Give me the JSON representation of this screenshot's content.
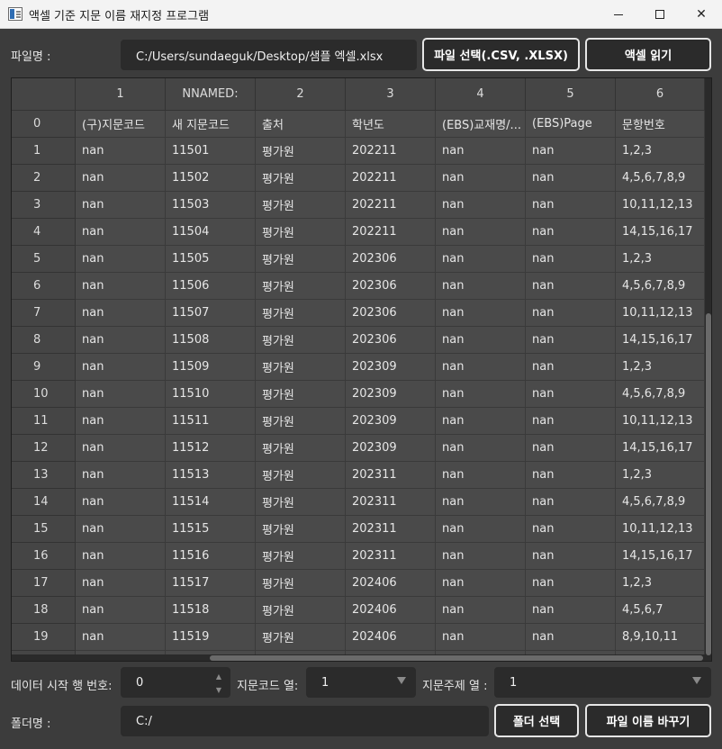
{
  "window": {
    "title": "액셀 기준 지문 이름 재지정 프로그램"
  },
  "file_row": {
    "label": "파일명 :",
    "path": "C:/Users/sundaeguk/Desktop/샘플 엑셀.xlsx",
    "select_button": "파일 선택(.CSV, .XLSX)",
    "read_button": "액셀 읽기"
  },
  "table": {
    "columns": [
      "1",
      "NNAMED:",
      "2",
      "3",
      "4",
      "5",
      "6"
    ],
    "row_numbers": [
      "0",
      "1",
      "2",
      "3",
      "4",
      "5",
      "6",
      "7",
      "8",
      "9",
      "10",
      "11",
      "12",
      "13",
      "14",
      "15",
      "16",
      "17",
      "18",
      "19"
    ],
    "rows": [
      [
        "(구)지문코드",
        "새 지문코드",
        "출처",
        "학년도",
        "(EBS)교재명/...",
        "(EBS)Page",
        "문항번호"
      ],
      [
        "nan",
        "11501",
        "평가원",
        "202211",
        "nan",
        "nan",
        "1,2,3"
      ],
      [
        "nan",
        "11502",
        "평가원",
        "202211",
        "nan",
        "nan",
        "4,5,6,7,8,9"
      ],
      [
        "nan",
        "11503",
        "평가원",
        "202211",
        "nan",
        "nan",
        "10,11,12,13"
      ],
      [
        "nan",
        "11504",
        "평가원",
        "202211",
        "nan",
        "nan",
        "14,15,16,17"
      ],
      [
        "nan",
        "11505",
        "평가원",
        "202306",
        "nan",
        "nan",
        "1,2,3"
      ],
      [
        "nan",
        "11506",
        "평가원",
        "202306",
        "nan",
        "nan",
        "4,5,6,7,8,9"
      ],
      [
        "nan",
        "11507",
        "평가원",
        "202306",
        "nan",
        "nan",
        "10,11,12,13"
      ],
      [
        "nan",
        "11508",
        "평가원",
        "202306",
        "nan",
        "nan",
        "14,15,16,17"
      ],
      [
        "nan",
        "11509",
        "평가원",
        "202309",
        "nan",
        "nan",
        "1,2,3"
      ],
      [
        "nan",
        "11510",
        "평가원",
        "202309",
        "nan",
        "nan",
        "4,5,6,7,8,9"
      ],
      [
        "nan",
        "11511",
        "평가원",
        "202309",
        "nan",
        "nan",
        "10,11,12,13"
      ],
      [
        "nan",
        "11512",
        "평가원",
        "202309",
        "nan",
        "nan",
        "14,15,16,17"
      ],
      [
        "nan",
        "11513",
        "평가원",
        "202311",
        "nan",
        "nan",
        "1,2,3"
      ],
      [
        "nan",
        "11514",
        "평가원",
        "202311",
        "nan",
        "nan",
        "4,5,6,7,8,9"
      ],
      [
        "nan",
        "11515",
        "평가원",
        "202311",
        "nan",
        "nan",
        "10,11,12,13"
      ],
      [
        "nan",
        "11516",
        "평가원",
        "202311",
        "nan",
        "nan",
        "14,15,16,17"
      ],
      [
        "nan",
        "11517",
        "평가원",
        "202406",
        "nan",
        "nan",
        "1,2,3"
      ],
      [
        "nan",
        "11518",
        "평가원",
        "202406",
        "nan",
        "nan",
        "4,5,6,7"
      ],
      [
        "nan",
        "11519",
        "평가원",
        "202406",
        "nan",
        "nan",
        "8,9,10,11"
      ]
    ]
  },
  "settings_row": {
    "start_row_label": "데이터 시작 행 번호:",
    "start_row_value": "0",
    "code_col_label": "지문코드 열:",
    "code_col_value": "1",
    "topic_col_label": "지문주제 열 :",
    "topic_col_value": "1"
  },
  "folder_row": {
    "label": "폴더명 :",
    "path": "C:/",
    "select_button": "폴더 선택",
    "rename_button": "파일 이름 바꾸기"
  },
  "colors": {
    "background": "#3c3c3c",
    "field": "#2b2b2b",
    "cell": "#4a4a4a",
    "header": "#454545"
  }
}
